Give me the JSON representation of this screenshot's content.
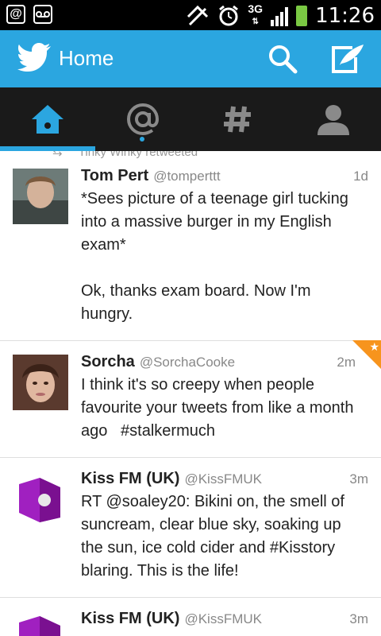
{
  "status_bar": {
    "time": "11:26",
    "network": "3G",
    "left_icons": [
      "at-notification-icon",
      "voicemail-icon"
    ],
    "right_icons": [
      "no-signal-icon",
      "alarm-icon",
      "network-3g-icon",
      "signal-icon",
      "battery-icon"
    ],
    "battery_color": "#7ac943"
  },
  "app_bar": {
    "title": "Home",
    "color": "#2ba6e0"
  },
  "tabs": [
    {
      "name": "home",
      "icon": "house-icon",
      "active": true
    },
    {
      "name": "connect",
      "icon": "at-icon",
      "active": false,
      "unread_dot": true
    },
    {
      "name": "discover",
      "icon": "hash-icon",
      "active": false
    },
    {
      "name": "me",
      "icon": "person-icon",
      "active": false
    }
  ],
  "tweets": [
    {
      "retweet_by": "Tinky Winky retweeted",
      "name": "Tom Pert",
      "handle": "@tomperttt",
      "time": "1d",
      "text": "*Sees picture of a teenage girl tucking into a massive burger in my English exam*\n\nOk, thanks exam board. Now I'm hungry."
    },
    {
      "name": "Sorcha",
      "handle": "@SorchaCooke",
      "time": "2m",
      "favorited": true,
      "text": "I think it's so creepy when people favourite your tweets from like a month ago   #stalkermuch"
    },
    {
      "name": "Kiss FM (UK)",
      "handle": "@KissFMUK",
      "time": "3m",
      "text": "RT @soaley20: Bikini on, the smell of suncream, clear blue sky, soaking up the sun, ice cold cider and #Kisstory blaring. This is the life!"
    },
    {
      "name": "Kiss FM (UK)",
      "handle": "@KissFMUK",
      "time": "3m",
      "text": ""
    }
  ]
}
